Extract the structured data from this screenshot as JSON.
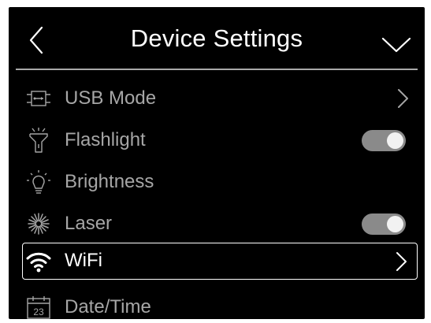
{
  "header": {
    "title": "Device Settings",
    "back_icon": "chevron-left-icon",
    "menu_icon": "chevron-down-icon"
  },
  "items": [
    {
      "label": "USB Mode",
      "icon": "usb-icon",
      "control": "chevron"
    },
    {
      "label": "Flashlight",
      "icon": "flashlight-icon",
      "control": "toggle",
      "on": true
    },
    {
      "label": "Brightness",
      "icon": "brightness-icon",
      "control": "none"
    },
    {
      "label": "Laser",
      "icon": "laser-icon",
      "control": "toggle",
      "on": true
    },
    {
      "label": "WiFi",
      "icon": "wifi-icon",
      "control": "chevron",
      "selected": true
    },
    {
      "label": "Date/Time",
      "icon": "calendar-icon",
      "control": "none",
      "icon_text": "23"
    }
  ],
  "colors": {
    "background": "#000000",
    "text_dim": "#a6a6a6",
    "text_active": "#ffffff",
    "toggle_track": "#8a8a8a",
    "toggle_knob": "#f2f2f2"
  }
}
